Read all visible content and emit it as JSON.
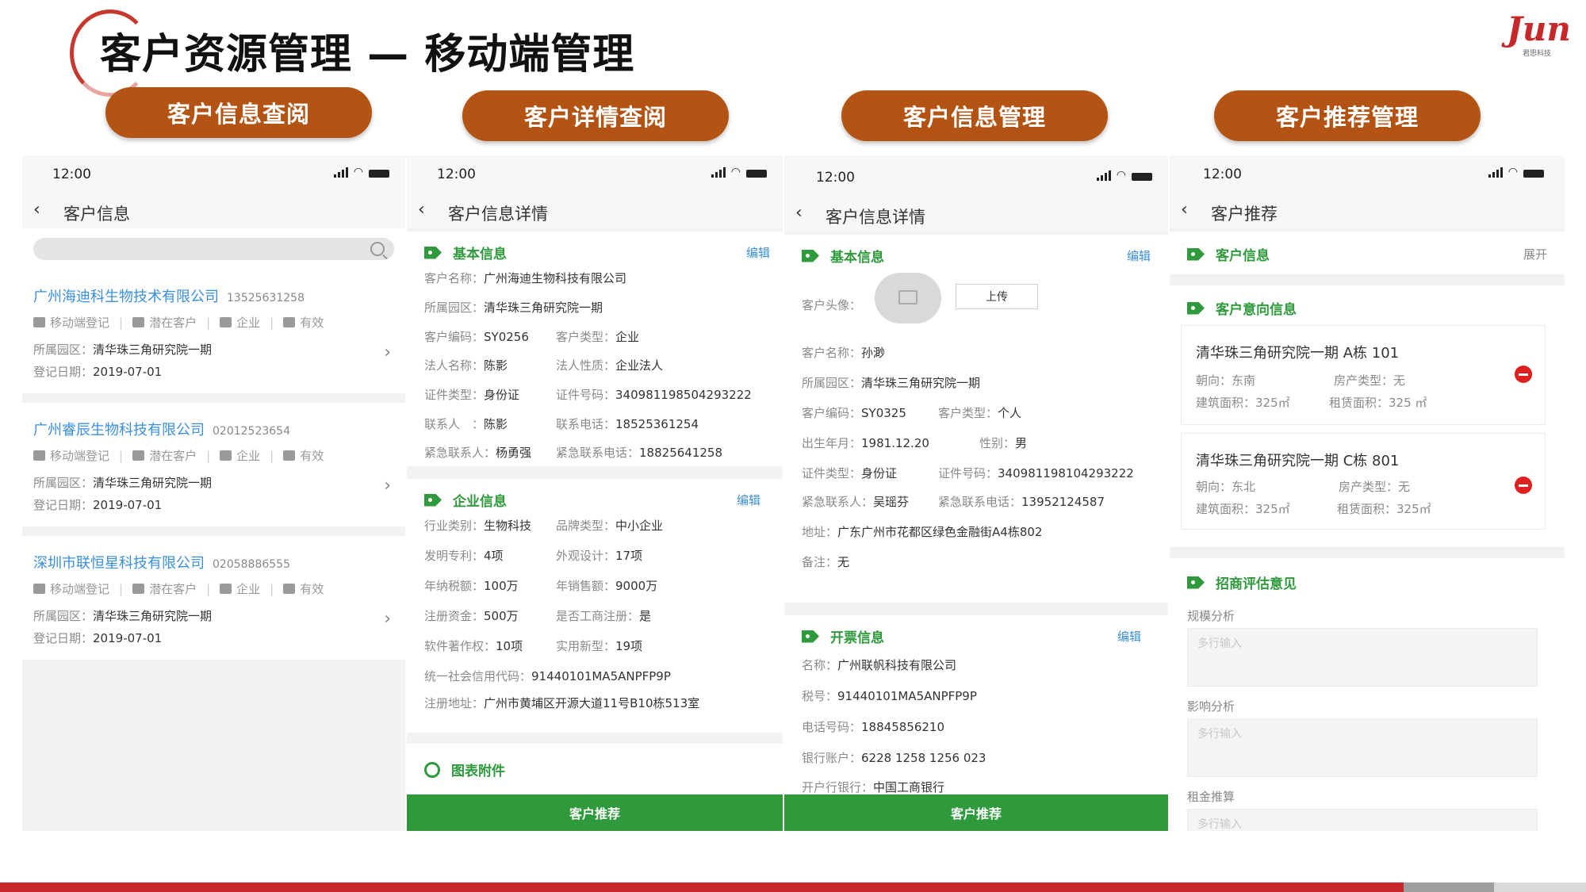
{
  "slide": {
    "title": "客户资源管理 — 移动端管理",
    "logo_text": "Jun",
    "logo_sub": "君思科技",
    "accent_color": "#b45414",
    "green_color": "#2f9a3c"
  },
  "sections": [
    "客户信息查阅",
    "客户详情查阅",
    "客户信息管理",
    "客户推荐管理"
  ],
  "status_time": "12:00",
  "panel1": {
    "title": "客户信息",
    "search_placeholder": "",
    "meta_labels": [
      "移动端登记",
      "潜在客户",
      "企业",
      "有效"
    ],
    "park_label": "所属园区：",
    "date_label": "登记日期：",
    "customers": [
      {
        "name": "广州海迪科生物技术有限公司",
        "phone": "13525631258",
        "park": "清华珠三角研究院一期",
        "date": "2019-07-01"
      },
      {
        "name": "广州睿辰生物科技有限公司",
        "phone": "02012523654",
        "park": "清华珠三角研究院一期",
        "date": "2019-07-01"
      },
      {
        "name": "深圳市联恒星科技有限公司",
        "phone": "02058886555",
        "park": "清华珠三角研究院一期",
        "date": "2019-07-01"
      }
    ]
  },
  "panel2": {
    "title": "客户信息详情",
    "edit_label": "编辑",
    "basic": {
      "head": "基本信息",
      "rows": [
        [
          {
            "l": "客户名称：",
            "v": "广州海迪生物科技有限公司"
          }
        ],
        [
          {
            "l": "所属园区：",
            "v": "清华珠三角研究院一期"
          }
        ],
        [
          {
            "l": "客户编码：",
            "v": "SY0256"
          },
          {
            "l": "客户类型：",
            "v": "企业"
          }
        ],
        [
          {
            "l": "法人名称：",
            "v": "陈影"
          },
          {
            "l": "法人性质：",
            "v": "企业法人"
          }
        ],
        [
          {
            "l": "证件类型：",
            "v": "身份证"
          },
          {
            "l": "证件号码：",
            "v": "340981198504293222"
          }
        ],
        [
          {
            "l": "联系人　：",
            "v": "陈影"
          },
          {
            "l": "联系电话：",
            "v": "18525361254"
          }
        ],
        [
          {
            "l": "紧急联系人：",
            "v": "杨勇强"
          },
          {
            "l": "紧急联系电话：",
            "v": "18825641258"
          }
        ]
      ]
    },
    "enterprise": {
      "head": "企业信息",
      "rows": [
        [
          {
            "l": "行业类别：",
            "v": "生物科技"
          },
          {
            "l": "品牌类型：",
            "v": "中小企业"
          }
        ],
        [
          {
            "l": "发明专利：",
            "v": "4项"
          },
          {
            "l": "外观设计：",
            "v": "17项"
          }
        ],
        [
          {
            "l": "年纳税额：",
            "v": "100万"
          },
          {
            "l": "年销售额：",
            "v": "9000万"
          }
        ],
        [
          {
            "l": "注册资金：",
            "v": "500万"
          },
          {
            "l": "是否工商注册：",
            "v": "是"
          }
        ],
        [
          {
            "l": "软件著作权：",
            "v": "10项"
          },
          {
            "l": "实用新型：",
            "v": "19项"
          }
        ],
        [
          {
            "l": "统一社会信用代码：",
            "v": "91440101MA5ANPFP9P"
          }
        ],
        [
          {
            "l": "注册地址：",
            "v": "广州市黄埔区开源大道11号B10栋513室"
          }
        ]
      ]
    },
    "attach_head": "图表附件",
    "button": "客户推荐"
  },
  "panel3": {
    "title": "客户信息详情",
    "edit_label": "编辑",
    "basic": {
      "head": "基本信息",
      "avatar_label": "客户头像：",
      "upload_label": "上传",
      "rows": [
        [
          {
            "l": "客户名称：",
            "v": "孙渺"
          }
        ],
        [
          {
            "l": "所属园区：",
            "v": "清华珠三角研究院一期"
          }
        ],
        [
          {
            "l": "客户编码：",
            "v": "SY0325"
          },
          {
            "l": "客户类型：",
            "v": "个人"
          }
        ],
        [
          {
            "l": "出生年月：",
            "v": "1981.12.20"
          },
          {
            "l": "性别：",
            "v": "男"
          }
        ],
        [
          {
            "l": "证件类型：",
            "v": "身份证"
          },
          {
            "l": "证件号码：",
            "v": "340981198104293222"
          }
        ],
        [
          {
            "l": "紧急联系人：",
            "v": "吴瑶芬"
          },
          {
            "l": "紧急联系电话：",
            "v": "13952124587"
          }
        ],
        [
          {
            "l": "地址：",
            "v": "广东广州市花都区绿色金融街A4栋802"
          }
        ],
        [
          {
            "l": "备注：",
            "v": "无"
          }
        ]
      ]
    },
    "invoice": {
      "head": "开票信息",
      "rows": [
        [
          {
            "l": "名称：",
            "v": "广州联帆科技有限公司"
          }
        ],
        [
          {
            "l": "税号：",
            "v": "91440101MA5ANPFP9P"
          }
        ],
        [
          {
            "l": "电话号码：",
            "v": "18845856210"
          }
        ],
        [
          {
            "l": "银行账户：",
            "v": "6228 1258 1256 023"
          }
        ],
        [
          {
            "l": "开户行银行：",
            "v": "中国工商银行"
          }
        ]
      ]
    },
    "button": "客户推荐"
  },
  "panel4": {
    "title": "客户推荐",
    "customer_head": "客户信息",
    "expand_label": "展开",
    "intent_head": "客户意向信息",
    "units": [
      {
        "title": "清华珠三角研究院一期 A栋 101",
        "orient_l": "朝向：",
        "orient": "东南",
        "type_l": "房产类型：",
        "type": "无",
        "area_l": "建筑面积：",
        "area": "325㎡",
        "rent_l": "租赁面积：",
        "rent": "325 ㎡"
      },
      {
        "title": "清华珠三角研究院一期 C栋 801",
        "orient_l": "朝向：",
        "orient": "东北",
        "type_l": "房产类型：",
        "type": "无",
        "area_l": "建筑面积：",
        "area": "325㎡",
        "rent_l": "租赁面积：",
        "rent": "325㎡"
      }
    ],
    "eval_head": "招商评估意见",
    "fields": [
      {
        "label": "规模分析",
        "placeholder": "多行输入"
      },
      {
        "label": "影响分析",
        "placeholder": "多行输入"
      },
      {
        "label": "租金推算",
        "placeholder": "多行输入"
      }
    ]
  }
}
